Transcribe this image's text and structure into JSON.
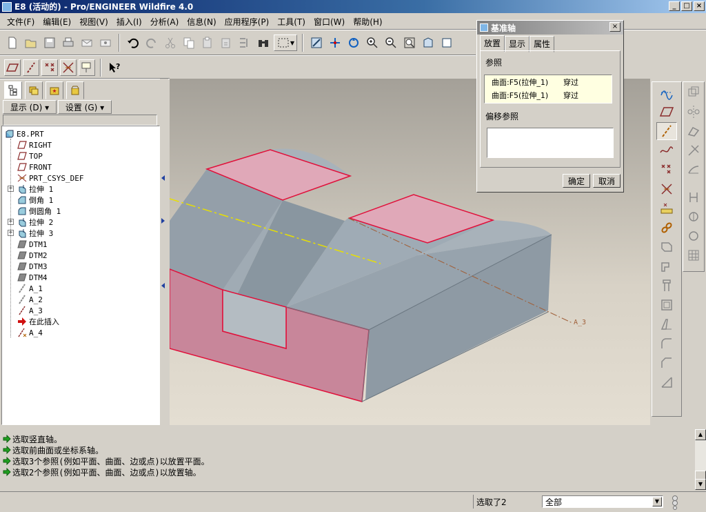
{
  "window": {
    "title": "E8 (活动的) - Pro/ENGINEER Wildfire 4.0"
  },
  "menu": [
    "文件(F)",
    "编辑(E)",
    "视图(V)",
    "插入(I)",
    "分析(A)",
    "信息(N)",
    "应用程序(P)",
    "工具(T)",
    "窗口(W)",
    "帮助(H)"
  ],
  "navigator": {
    "show_label": "显示 (D) ▾",
    "settings_label": "设置 (G) ▾",
    "tree": [
      {
        "label": "E8.PRT",
        "icon": "part-icon",
        "level": 0,
        "expandable": false
      },
      {
        "label": "RIGHT",
        "icon": "datum-plane-icon",
        "level": 1,
        "expandable": false
      },
      {
        "label": "TOP",
        "icon": "datum-plane-icon",
        "level": 1,
        "expandable": false
      },
      {
        "label": "FRONT",
        "icon": "datum-plane-icon",
        "level": 1,
        "expandable": false
      },
      {
        "label": "PRT_CSYS_DEF",
        "icon": "csys-icon",
        "level": 1,
        "expandable": false
      },
      {
        "label": "拉伸 1",
        "icon": "extrude-icon",
        "level": 1,
        "expandable": true
      },
      {
        "label": "倒角 1",
        "icon": "chamfer-icon",
        "level": 1,
        "expandable": false
      },
      {
        "label": "倒圆角 1",
        "icon": "round-icon",
        "level": 1,
        "expandable": false
      },
      {
        "label": "拉伸 2",
        "icon": "extrude-icon",
        "level": 1,
        "expandable": true
      },
      {
        "label": "拉伸 3",
        "icon": "extrude-icon",
        "level": 1,
        "expandable": true
      },
      {
        "label": "DTM1",
        "icon": "datum-plane-gray-icon",
        "level": 1,
        "expandable": false
      },
      {
        "label": "DTM2",
        "icon": "datum-plane-gray-icon",
        "level": 1,
        "expandable": false
      },
      {
        "label": "DTM3",
        "icon": "datum-plane-gray-icon",
        "level": 1,
        "expandable": false
      },
      {
        "label": "DTM4",
        "icon": "datum-plane-gray-icon",
        "level": 1,
        "expandable": false
      },
      {
        "label": "A_1",
        "icon": "axis-gray-icon",
        "level": 1,
        "expandable": false
      },
      {
        "label": "A_2",
        "icon": "axis-gray-icon",
        "level": 1,
        "expandable": false
      },
      {
        "label": "A_3",
        "icon": "axis-icon",
        "level": 1,
        "expandable": false
      },
      {
        "label": "在此插入",
        "icon": "insert-here-icon",
        "level": 1,
        "expandable": false
      },
      {
        "label": "A_4",
        "icon": "axis-new-icon",
        "level": 1,
        "expandable": false
      }
    ]
  },
  "viewport": {
    "axis_label": "A_3"
  },
  "dialog": {
    "title": "基准轴",
    "tabs": [
      "放置",
      "显示",
      "属性"
    ],
    "references_label": "参照",
    "references": [
      {
        "ref": "曲面:F5(拉伸_1)",
        "type": "穿过"
      },
      {
        "ref": "曲面:F5(拉伸_1)",
        "type": "穿过"
      }
    ],
    "offset_label": "偏移参照",
    "ok_label": "确定",
    "cancel_label": "取消"
  },
  "messages": [
    "选取竖直轴。",
    "选取前曲面或坐标系轴。",
    "选取3个参照(例如平面、曲面、边或点)以放置平面。",
    "选取2个参照(例如平面、曲面、边或点)以放置轴。"
  ],
  "status": {
    "selected": "选取了2",
    "filter": "全部"
  },
  "colors": {
    "model": "#97a3ad",
    "highlight": "#e0a8b8",
    "edge": "#e0103a",
    "axis_yellow": "#e8e000",
    "axis_brown": "#a0603a"
  }
}
